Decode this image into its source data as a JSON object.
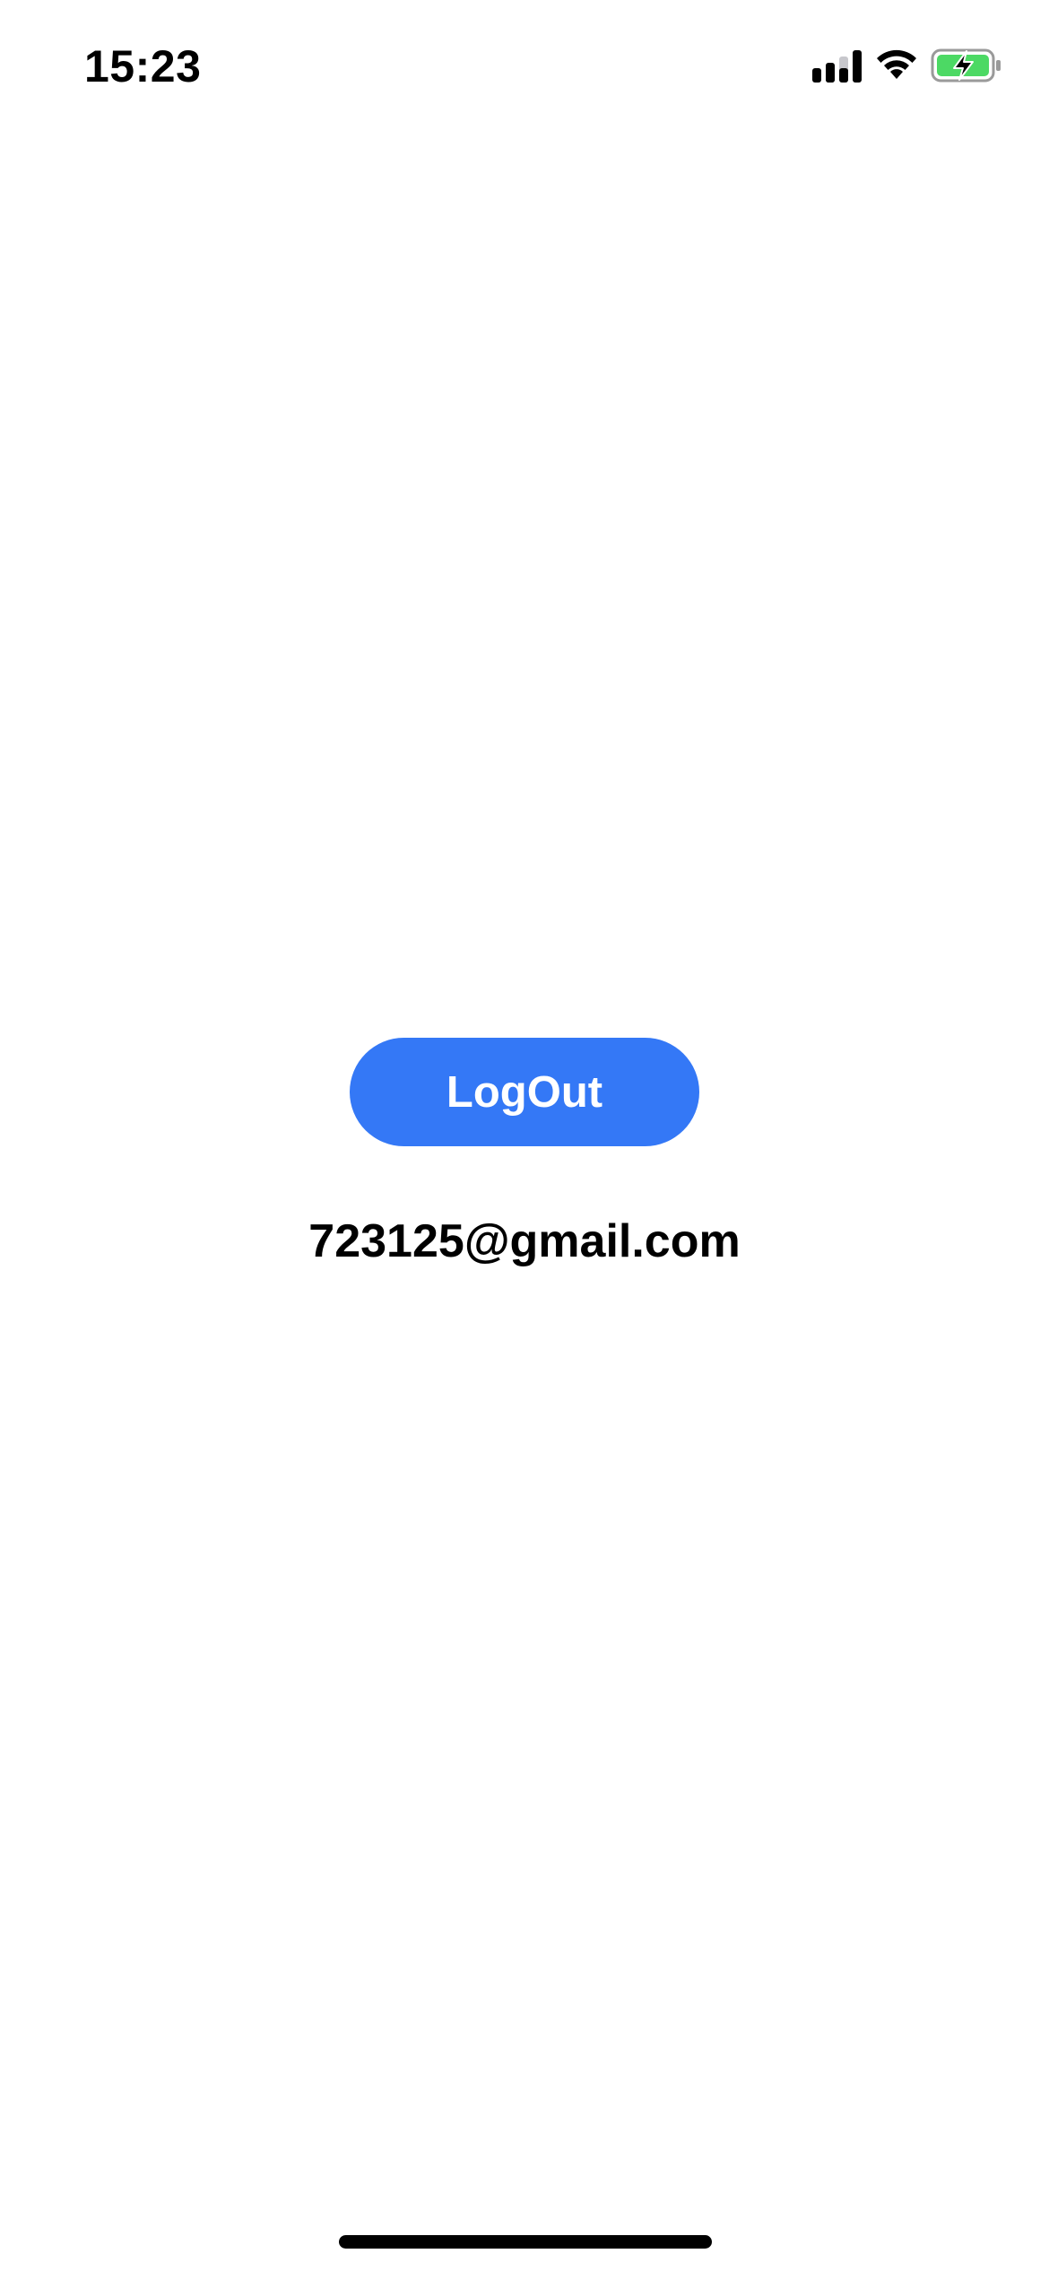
{
  "status_bar": {
    "time": "15:23",
    "icons": [
      "signal-icon",
      "wifi-icon",
      "battery-charging-icon"
    ]
  },
  "colors": {
    "accent": "#3478f6",
    "battery_fill": "#4cd964",
    "background": "#ffffff",
    "text": "#000000"
  },
  "main": {
    "logout_label": "LogOut",
    "user_email": "723125@gmail.com"
  }
}
